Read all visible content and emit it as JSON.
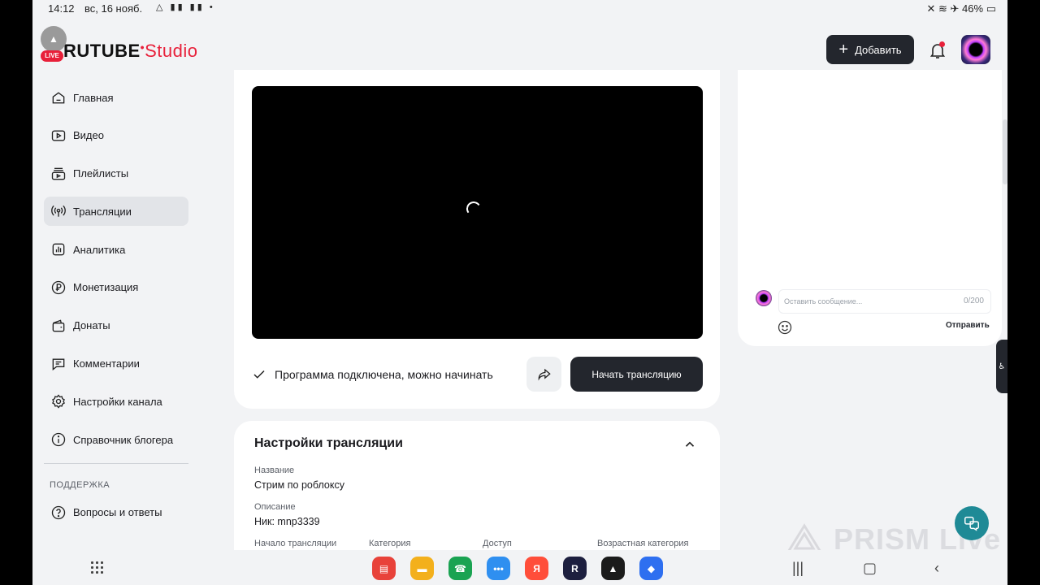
{
  "status_bar": {
    "time": "14:12",
    "date": "вс, 16 нояб.",
    "battery": "46%"
  },
  "header": {
    "logo_main": "RUTUBE",
    "logo_sub": "Studio",
    "live_badge": "LIVE",
    "add_button": "Добавить"
  },
  "sidebar": {
    "items": [
      {
        "label": "Главная",
        "icon": "home-icon"
      },
      {
        "label": "Видео",
        "icon": "video-icon"
      },
      {
        "label": "Плейлисты",
        "icon": "playlist-icon"
      },
      {
        "label": "Трансляции",
        "icon": "broadcast-icon",
        "active": true
      },
      {
        "label": "Аналитика",
        "icon": "analytics-icon"
      },
      {
        "label": "Монетизация",
        "icon": "ruble-icon"
      },
      {
        "label": "Донаты",
        "icon": "wallet-icon"
      },
      {
        "label": "Комментарии",
        "icon": "comment-icon"
      },
      {
        "label": "Настройки канала",
        "icon": "gear-icon"
      },
      {
        "label": "Справочник блогера",
        "icon": "info-icon"
      }
    ],
    "support_title": "ПОДДЕРЖКА",
    "support_items": [
      {
        "label": "Вопросы и ответы",
        "icon": "question-icon"
      }
    ]
  },
  "stream": {
    "status_text": "Программа подключена, можно начинать",
    "start_button": "Начать трансляцию"
  },
  "settings": {
    "title": "Настройки трансляции",
    "name_label": "Название",
    "name_value": "Стрим по роблоксу",
    "description_label": "Описание",
    "description_value": "Ник: mnp3339",
    "start_label": "Начало трансляции",
    "category_label": "Категория",
    "access_label": "Доступ",
    "age_label": "Возрастная категория"
  },
  "chat": {
    "placeholder": "Оставить сообщение...",
    "counter": "0/200",
    "send_button": "Отправить"
  },
  "watermark": "PRISM Live",
  "colors": {
    "accent": "#e8203a",
    "dark_button": "#23262d",
    "background": "#f2f3f5",
    "help_fab": "#1f8a96"
  }
}
